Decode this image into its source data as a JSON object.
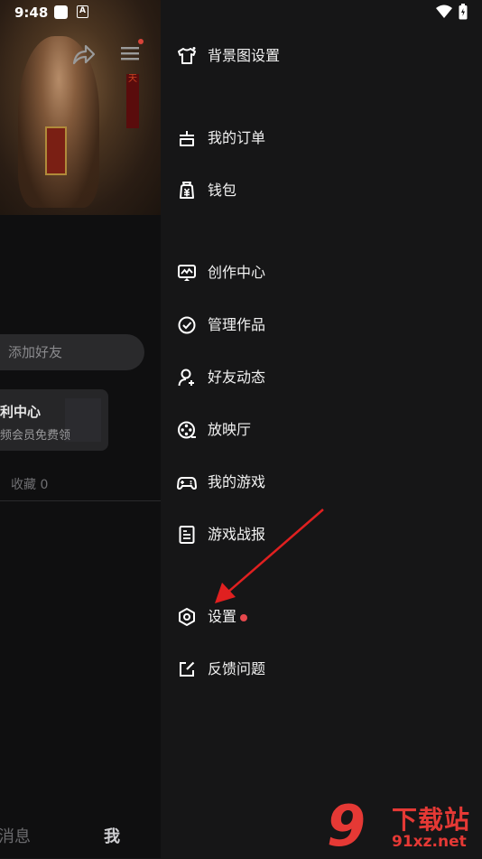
{
  "status_bar": {
    "time": "9:48",
    "notif_icon": "A"
  },
  "background_page": {
    "banner_badge": "天",
    "add_friend": "添加好友",
    "benefit_title": "利中心",
    "benefit_sub": "频会员免费领",
    "collect": "收藏 0",
    "nav_messages": "消息",
    "nav_me": "我"
  },
  "drawer": {
    "items": [
      {
        "label": "背景图设置",
        "icon": "shirt-icon"
      },
      {
        "label": "我的订单",
        "icon": "order-icon"
      },
      {
        "label": "钱包",
        "icon": "wallet-icon"
      },
      {
        "label": "创作中心",
        "icon": "creator-icon"
      },
      {
        "label": "管理作品",
        "icon": "check-circle-icon"
      },
      {
        "label": "好友动态",
        "icon": "user-plus-icon"
      },
      {
        "label": "放映厅",
        "icon": "film-reel-icon"
      },
      {
        "label": "我的游戏",
        "icon": "gamepad-icon"
      },
      {
        "label": "游戏战报",
        "icon": "report-icon"
      },
      {
        "label": "设置",
        "icon": "settings-icon"
      },
      {
        "label": "反馈问题",
        "icon": "feedback-icon"
      }
    ],
    "settings_has_badge": true
  },
  "watermark": {
    "brand": "下载站",
    "url": "91xz.net",
    "logo": "9"
  },
  "colors": {
    "accent_red": "#e5484d",
    "arrow_red": "#e02020"
  }
}
